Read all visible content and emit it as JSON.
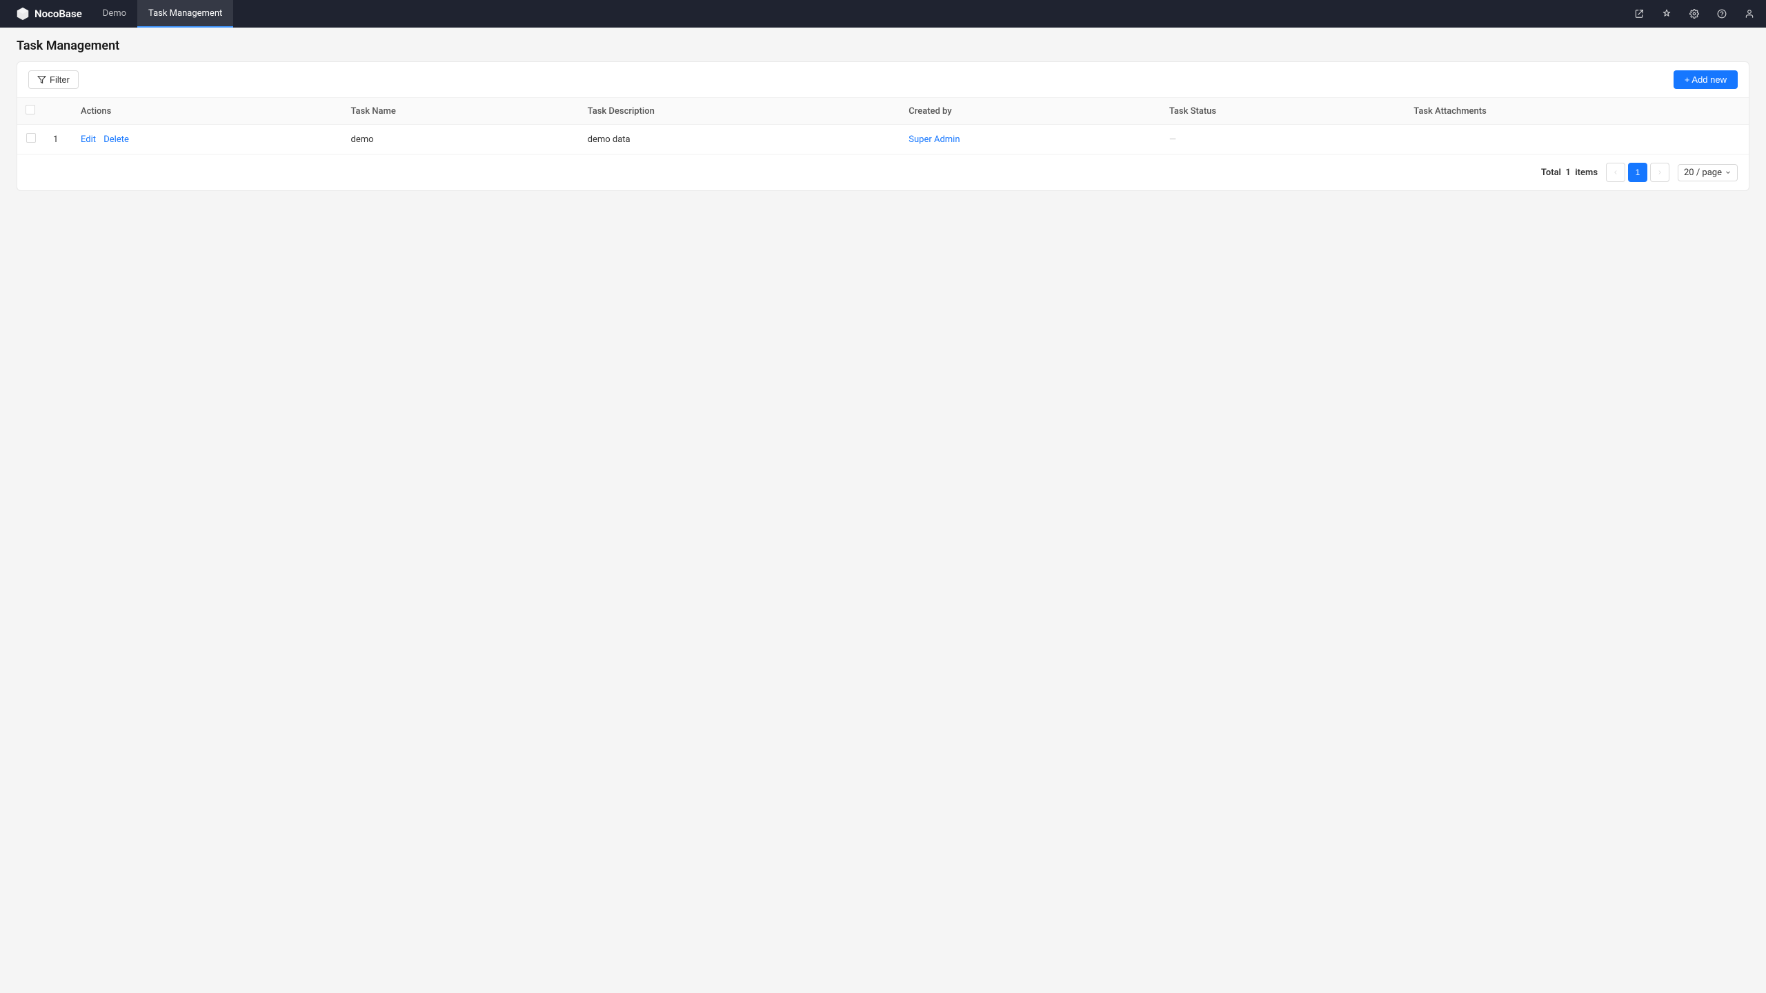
{
  "app": {
    "logo_text": "NocoBase",
    "nav_tabs": [
      {
        "label": "Demo",
        "active": false
      },
      {
        "label": "Task Management",
        "active": true
      }
    ]
  },
  "header": {
    "page_title": "Task Management"
  },
  "toolbar": {
    "filter_label": "Filter",
    "add_new_label": "+ Add new"
  },
  "table": {
    "columns": [
      {
        "key": "actions",
        "label": "Actions"
      },
      {
        "key": "task_name",
        "label": "Task Name"
      },
      {
        "key": "task_description",
        "label": "Task Description"
      },
      {
        "key": "created_by",
        "label": "Created by"
      },
      {
        "key": "task_status",
        "label": "Task Status"
      },
      {
        "key": "task_attachments",
        "label": "Task Attachments"
      }
    ],
    "rows": [
      {
        "row_num": "1",
        "edit_label": "Edit",
        "delete_label": "Delete",
        "task_name": "demo",
        "task_description": "demo data",
        "created_by": "Super Admin",
        "task_status": "—",
        "task_attachments": ""
      }
    ]
  },
  "pagination": {
    "total_prefix": "Total",
    "total_count": "1",
    "total_suffix": "items",
    "current_page": "1",
    "page_size": "20 / page",
    "prev_disabled": true,
    "next_disabled": true
  }
}
